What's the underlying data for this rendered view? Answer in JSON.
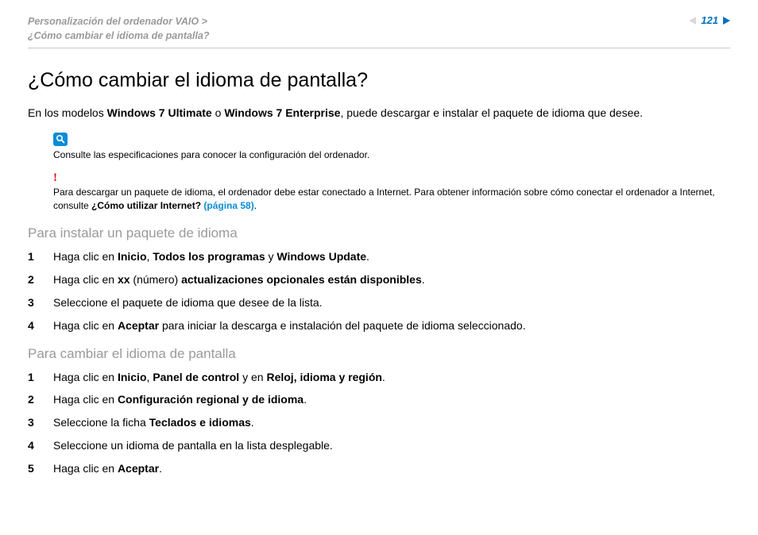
{
  "breadcrumb": {
    "line1": "Personalización del ordenador VAIO >",
    "line2": "¿Cómo cambiar el idioma de pantalla?"
  },
  "pagenum": "121",
  "title": "¿Cómo cambiar el idioma de pantalla?",
  "intro": {
    "pre": "En los modelos ",
    "b1": "Windows 7 Ultimate",
    "mid": " o ",
    "b2": "Windows 7 Enterprise",
    "post": ", puede descargar e instalar el paquete de idioma que desee."
  },
  "spec_note": "Consulte las especificaciones para conocer la configuración del ordenador.",
  "warn": {
    "pre": "Para descargar un paquete de idioma, el ordenador debe estar conectado a Internet. Para obtener información sobre cómo conectar el ordenador a Internet, consulte ",
    "b": "¿Cómo utilizar Internet?",
    "link": " (página 58)",
    "post": "."
  },
  "sec1": {
    "title": "Para instalar un paquete de idioma",
    "s1": {
      "n": "1",
      "a": "Haga clic en ",
      "b1": "Inicio",
      "c": ", ",
      "b2": "Todos los programas",
      "d": " y ",
      "b3": "Windows Update",
      "e": "."
    },
    "s2": {
      "n": "2",
      "a": "Haga clic en ",
      "b1": "xx",
      "c": " (número) ",
      "b2": "actualizaciones opcionales están disponibles",
      "d": "."
    },
    "s3": {
      "n": "3",
      "a": "Seleccione el paquete de idioma que desee de la lista."
    },
    "s4": {
      "n": "4",
      "a": "Haga clic en ",
      "b1": "Aceptar",
      "c": " para iniciar la descarga e instalación del paquete de idioma seleccionado."
    }
  },
  "sec2": {
    "title": "Para cambiar el idioma de pantalla",
    "s1": {
      "n": "1",
      "a": "Haga clic en ",
      "b1": "Inicio",
      "c": ", ",
      "b2": "Panel de control",
      "d": " y en ",
      "b3": "Reloj, idioma y región",
      "e": "."
    },
    "s2": {
      "n": "2",
      "a": "Haga clic en ",
      "b1": "Configuración regional y de idioma",
      "c": "."
    },
    "s3": {
      "n": "3",
      "a": "Seleccione la ficha ",
      "b1": "Teclados e idiomas",
      "c": "."
    },
    "s4": {
      "n": "4",
      "a": "Seleccione un idioma de pantalla en la lista desplegable."
    },
    "s5": {
      "n": "5",
      "a": "Haga clic en ",
      "b1": "Aceptar",
      "c": "."
    }
  }
}
